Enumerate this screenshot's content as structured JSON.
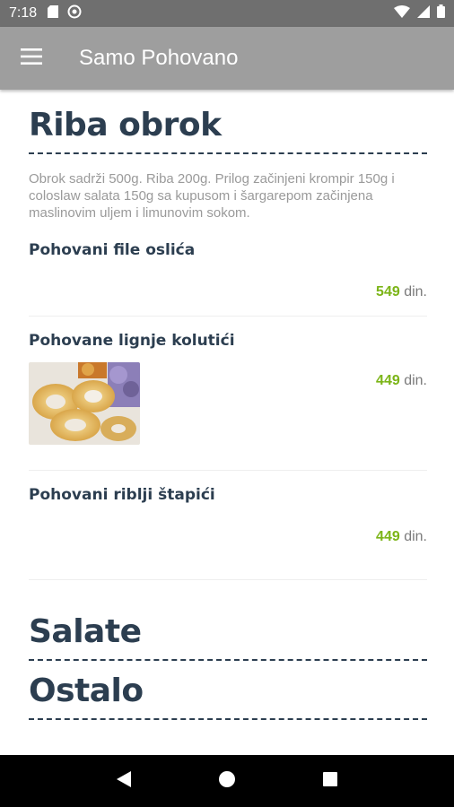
{
  "status_bar": {
    "time": "7:18",
    "left_icons": [
      "sd-card-icon",
      "vpn-icon"
    ],
    "right_icons": [
      "wifi-icon",
      "signal-icon",
      "battery-icon"
    ],
    "bg_color": "#6f6f6f"
  },
  "app_bar": {
    "title": "Samo Pohovano",
    "menu_icon": "hamburger-menu-icon",
    "bg_color": "#9e9e9e"
  },
  "sections": [
    {
      "title": "Riba obrok",
      "description": "Obrok sadrži 500g. Riba 200g. Prilog začinjeni krompir 150g i coloslaw salata 150g sa kupusom i šargarepom začinjena maslinovim uljem i limunovim sokom.",
      "items": [
        {
          "name": "Pohovani file oslića",
          "price": "549",
          "currency": "din.",
          "has_image": false
        },
        {
          "name": "Pohovane lignje kolutići",
          "price": "449",
          "currency": "din.",
          "has_image": true
        },
        {
          "name": "Pohovani riblji štapići",
          "price": "449",
          "currency": "din.",
          "has_image": false
        }
      ]
    },
    {
      "title": "Salate"
    },
    {
      "title": "Ostalo"
    }
  ],
  "nav_bar": {
    "back_icon": "back-triangle-icon",
    "home_icon": "home-circle-icon",
    "recents_icon": "recents-square-icon"
  },
  "colors": {
    "heading": "#2c3e50",
    "price": "#7cb518",
    "muted_text": "#9a9a9a"
  }
}
